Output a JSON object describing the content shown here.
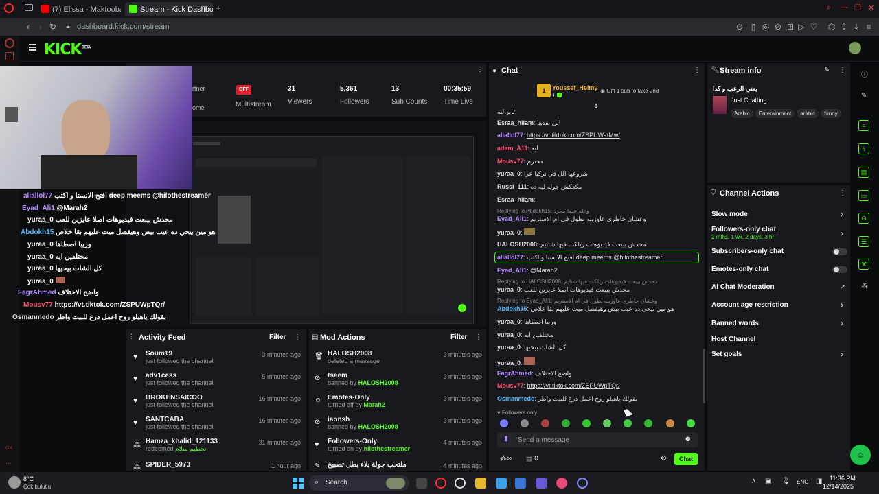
{
  "browser": {
    "tabs": [
      {
        "label": "(7) Elissa - Maktooba Leel"
      },
      {
        "label": "Stream - Kick Dashboard"
      }
    ],
    "url": "dashboard.kick.com/stream"
  },
  "header": {
    "logo": "KICK",
    "logo_sup": "BETA"
  },
  "stats": [
    {
      "value": "OFF",
      "label": "Multistream"
    },
    {
      "value": "31",
      "label": "Viewers"
    },
    {
      "value": "5,361",
      "label": "Followers"
    },
    {
      "value": "13",
      "label": "Sub Counts"
    },
    {
      "value": "00:35:59",
      "label": "Time Live"
    }
  ],
  "partner_label_1": "rtner",
  "partner_label_2": "ome",
  "activity_feed": {
    "title": "Activity Feed",
    "filter": "Filter",
    "items": [
      {
        "name": "Soum19",
        "sub": "just followed the channel",
        "time": "3 minutes ago"
      },
      {
        "name": "adv1cess",
        "sub": "just followed the channel",
        "time": "5 minutes ago"
      },
      {
        "name": "BROKENSAICOO",
        "sub": "just followed the channel",
        "time": "16 minutes ago"
      },
      {
        "name": "SANTCABA",
        "sub": "just followed the channel",
        "time": "16 minutes ago"
      },
      {
        "name": "Hamza_khalid_121133",
        "sub": "redeemed",
        "extra": "تحطيم سلام",
        "time": "31 minutes ago"
      },
      {
        "name": "SPIDER_5973",
        "sub": "",
        "time": "1 hour ago"
      }
    ]
  },
  "mod_actions": {
    "title": "Mod Actions",
    "filter": "Filter",
    "items": [
      {
        "name": "HALOSH2008",
        "sub": "deleted a message",
        "by": "",
        "time": "3 minutes ago"
      },
      {
        "name": "tseem",
        "sub": "banned by",
        "by": "HALOSH2008",
        "time": "3 minutes ago"
      },
      {
        "name": "Emotes-Only",
        "sub": "turned off by",
        "by": "Marah2",
        "time": "3 minutes ago"
      },
      {
        "name": "iannsb",
        "sub": "banned by",
        "by": "HALOSH2008",
        "time": "3 minutes ago"
      },
      {
        "name": "Followers-Only",
        "sub": "turned on by",
        "by": "hilothestreamer",
        "time": "4 minutes ago"
      },
      {
        "name": "ملتحب جولة بلاء بطل تصبيخ",
        "sub": "",
        "by": "",
        "time": "4 minutes ago"
      }
    ]
  },
  "chat": {
    "title": "Chat",
    "top_user": "Youssef_Helmy",
    "top_count": "1",
    "gift_text": "Gift 1 sub to take 2nd",
    "lines": [
      {
        "user": "",
        "text": "عايز ليه",
        "color": "#ddd"
      },
      {
        "user": "Esraa_hilam",
        "text": "الي بعدها",
        "color": "#ddd"
      },
      {
        "user": "aliallol77",
        "text": "https://vt.tiktok.com/ZSPUWatMw/",
        "color": "#b48aff"
      },
      {
        "user": "adam_A11",
        "text": "ليه",
        "color": "#ff4d6a"
      },
      {
        "user": "Mousv77",
        "text": "محترم",
        "color": "#ff4d6a"
      },
      {
        "user": "yuraa_0",
        "text": "شروعها الل في تركيا عرا",
        "color": "#ddd"
      },
      {
        "user": "Russi_111",
        "text": "مكعكش جوله ليه ده",
        "color": "#ddd"
      },
      {
        "user": "Esraa_hilam",
        "text": "",
        "color": "#ddd"
      }
    ],
    "reply1": "Replying to Abdokh15: والله علما مجرد",
    "line_eyad1_user": "Eyad_Ali1",
    "line_eyad1_text": "وعشان خاطري عاوزينه يطول في ام الاستريم",
    "line_yuraa_emote_user": "yuraa_0",
    "line_halosh_user": "HALOSH2008",
    "line_halosh_text": "محدش بيبعت فيديوهات ريلكت فيها شتايم",
    "highlight_user": "aliallol77",
    "highlight_text": "افتح الانستا و اكتب deep meems @hilothestreamer",
    "line_eyad2_user": "Eyad_Ali1",
    "line_eyad2_text": "@Marah2",
    "reply2": "Replying to HALOSH2008: محدش بيبعت فيديوهات ريلكت فيها شتايم",
    "line_yuraa2_user": "yuraa_0",
    "line_yuraa2_text": "محدش بيبعت فيديوهات اصلا عايزين للعب",
    "reply3": "Replying to Eyad_Ali1: وعشان خاطري عاوزينه يطول في ام الاستريم",
    "line_abdok_user": "Abdokh15",
    "line_abdok_text": "هو مين بيحي ده عيب بيض وهيفضل ميت عليهم بقا خلاص",
    "line_yuraa3_user": "yuraa_0",
    "line_yuraa3_text": "وريبا اصطاها",
    "line_yuraa4_user": "yuraa_0",
    "line_yuraa4_text": "مختلفين ايه",
    "line_yuraa5_user": "yuraa_0",
    "line_yuraa5_text": "كل الشات بيحيها",
    "line_yuraa6_user": "yuraa_0",
    "line_fagr_user": "FagrAhmed",
    "line_fagr_text": "واضح الاختلاف",
    "line_mousv_user": "Mousv77",
    "line_mousv_text": "https://vt.tiktok.com/ZSPUWpTQr/",
    "line_osman_user": "Osmanmedo",
    "line_osman_text": "بقولك ياهيلو روح اعمل درع للبيت واظر",
    "followers_only": "Followers only",
    "input_placeholder": "Send a message",
    "count": "0",
    "send": "Chat"
  },
  "stream_info": {
    "title": "Stream info",
    "stream_title": "يعني الرعب و كدا",
    "category": "Just Chatting",
    "tags": [
      "Arabic",
      "Enterainment",
      "arabic",
      "funny"
    ]
  },
  "channel_actions": {
    "title": "Channel Actions",
    "items": [
      {
        "label": "Slow mode"
      },
      {
        "label": "Followers-only chat",
        "sub": "2 mths, 1 wk, 2 days, 3 hr"
      },
      {
        "label": "Subscribers-only chat"
      },
      {
        "label": "Emotes-only chat"
      },
      {
        "label": "AI Chat Moderation"
      },
      {
        "label": "Account age restriction"
      },
      {
        "label": "Banned words"
      },
      {
        "label": "Host Channel"
      },
      {
        "label": "Set goals"
      }
    ]
  },
  "overlay_chat": [
    {
      "user": "aliallol77",
      "text": "افتح الانستا و اكتب deep meems @hilothestreamer",
      "color": "#b48aff"
    },
    {
      "user": "Eyad_Ali1",
      "text": "@Marah2",
      "color": "#b48aff"
    },
    {
      "user": "yuraa_0",
      "text": "محدش بيبعت فيديوهات اصلا عايزين للعب",
      "color": "#fff"
    },
    {
      "user": "Abdokh15",
      "text": "هو مين بيحي ده عيب بيض وهيفضل ميت عليهم بقا خلاص",
      "color": "#4fb8ff"
    },
    {
      "user": "yuraa_0",
      "text": "وريبا اصطاها",
      "color": "#fff"
    },
    {
      "user": "yuraa_0",
      "text": "مختلفين ايه",
      "color": "#fff"
    },
    {
      "user": "yuraa_0",
      "text": "كل الشات بيحيها",
      "color": "#fff"
    },
    {
      "user": "yuraa_0",
      "text": "",
      "color": "#fff"
    },
    {
      "user": "FagrAhmed",
      "text": "واضح الاختلاف",
      "color": "#b48aff"
    },
    {
      "user": "Mousv77",
      "text": "https://vt.tiktok.com/ZSPUWpTQr/",
      "color": "#ff4d6a"
    },
    {
      "user": "Osmanmedo",
      "text": "بقولك ياهيلو روح اعمل درع للبيت واظر",
      "color": "#ddd"
    }
  ],
  "taskbar": {
    "weather_temp": "8°C",
    "weather_desc": "Çok bulutlu",
    "search": "Search",
    "lang": "ENG",
    "time": "11:36 PM",
    "date": "12/14/2025"
  }
}
